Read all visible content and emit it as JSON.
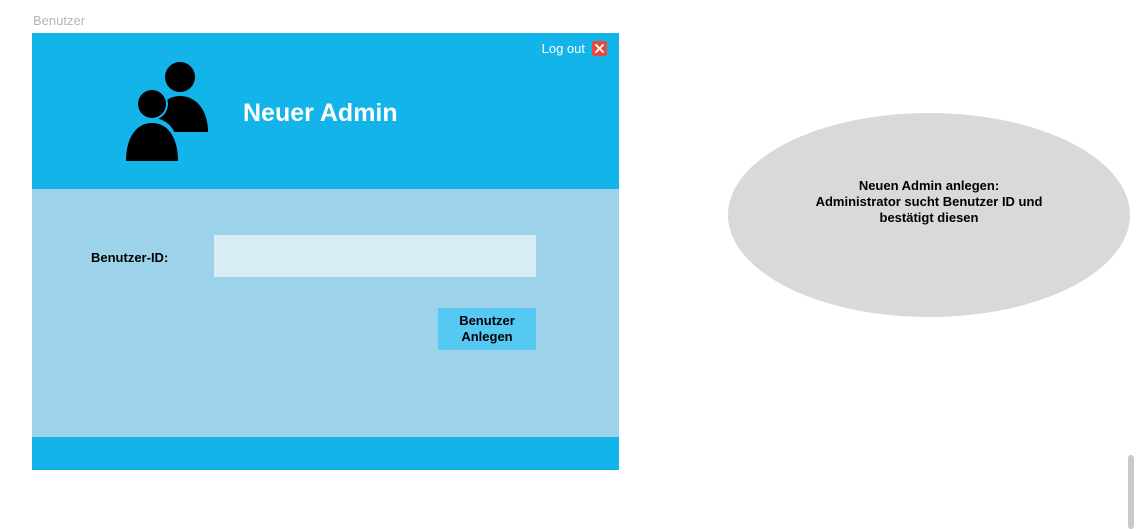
{
  "frame": {
    "label": "Benutzer"
  },
  "header": {
    "title": "Neuer Admin",
    "logout_label": "Log out",
    "icon": "users-icon",
    "close_icon": "close-icon",
    "accent_color": "#12b4ea",
    "close_color": "#e8493d"
  },
  "form": {
    "user_id_label": "Benutzer-ID:",
    "user_id_value": "",
    "user_id_placeholder": "",
    "submit_label": "Benutzer\nAnlegen",
    "panel_color": "#9dd3ea",
    "button_color": "#55c9f2"
  },
  "note": {
    "lines": [
      "Neuen Admin anlegen:",
      "Administrator sucht Benutzer ID und",
      "bestätigt diesen"
    ],
    "color": "#d9d9d9"
  }
}
